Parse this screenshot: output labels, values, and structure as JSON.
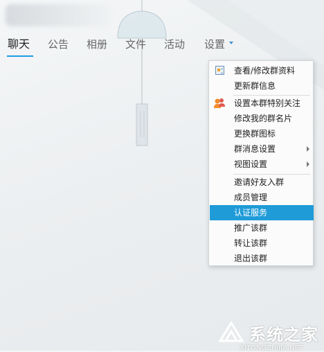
{
  "tabs": [
    {
      "label": "聊天",
      "active": true
    },
    {
      "label": "公告"
    },
    {
      "label": "相册"
    },
    {
      "label": "文件"
    },
    {
      "label": "活动"
    },
    {
      "label": "设置"
    }
  ],
  "accent_color": "#1d9ce6",
  "menu": {
    "items": [
      {
        "label": "查看/修改群资料",
        "icon": "group-profile-icon"
      },
      {
        "label": "更新群信息"
      },
      {
        "label": "设置本群特别关注",
        "icon": "special-follow-icon"
      },
      {
        "label": "修改我的群名片"
      },
      {
        "label": "更换群图标"
      },
      {
        "label": "群消息设置",
        "has_submenu": true
      },
      {
        "label": "视图设置",
        "has_submenu": true
      },
      {
        "label": "邀请好友入群"
      },
      {
        "label": "成员管理"
      },
      {
        "label": "认证服务",
        "highlighted": true
      },
      {
        "label": "推广该群"
      },
      {
        "label": "转让该群"
      },
      {
        "label": "退出该群"
      }
    ]
  },
  "watermark": {
    "name": "系统之家",
    "url": "XITONGZHIJIA.NET"
  }
}
